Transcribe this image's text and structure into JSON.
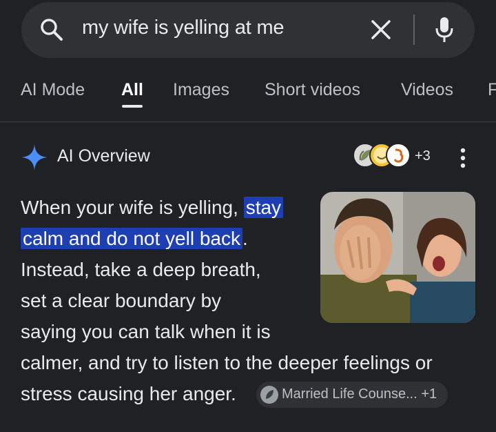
{
  "search": {
    "query": "my wife is yelling at me"
  },
  "tabs": [
    {
      "label": "AI Mode"
    },
    {
      "label": "All"
    },
    {
      "label": "Images"
    },
    {
      "label": "Short videos"
    },
    {
      "label": "Videos"
    },
    {
      "label": "F"
    }
  ],
  "ai_overview": {
    "title": "AI Overview",
    "sources_more": "+3",
    "lines": {
      "l1a": "When your wife is yelling, ",
      "l1b": "stay",
      "l2a": "calm and do not yell back",
      "l2b": ".",
      "l3": "Instead, take a deep breath,",
      "l4": "set a clear boundary by",
      "l5": "saying you can talk when it is",
      "l6": "calmer, and try to listen to the deeper feelings or",
      "l7": "stress causing her anger."
    },
    "source_chip": "Married Life Counse... +1"
  },
  "colors": {
    "background": "#202124",
    "search_bar": "#303134",
    "highlight": "#1e3fb4",
    "ai_spark": "#4c8df6"
  }
}
